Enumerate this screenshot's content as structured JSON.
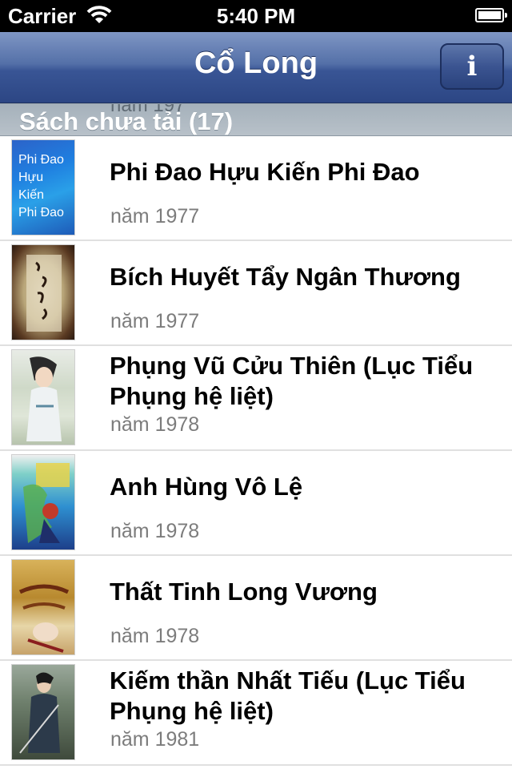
{
  "status_bar": {
    "carrier": "Carrier",
    "time": "5:40 PM"
  },
  "nav": {
    "title": "Cổ Long",
    "info_label": "i"
  },
  "section": {
    "label": "Sách chưa tải (17)",
    "ghost": "năm 197"
  },
  "books": [
    {
      "title": "Phi Đao Hựu Kiến Phi Đao",
      "year": "năm 1977",
      "cover_text": [
        "Phi Đao",
        "Hựu",
        "Kiến",
        "Phi Đao"
      ]
    },
    {
      "title": "Bích Huyết Tẩy Ngân Thương",
      "year": "năm 1977"
    },
    {
      "title": "Phụng Vũ Cửu Thiên (Lục Tiểu Phụng hệ liệt)",
      "year": "năm 1978"
    },
    {
      "title": "Anh Hùng Vô Lệ",
      "year": "năm 1978"
    },
    {
      "title": "Thất Tinh Long Vương",
      "year": "năm 1978"
    },
    {
      "title": "Kiếm thần Nhất Tiếu (Lục Tiểu Phụng hệ liệt)",
      "year": "năm 1981"
    }
  ]
}
